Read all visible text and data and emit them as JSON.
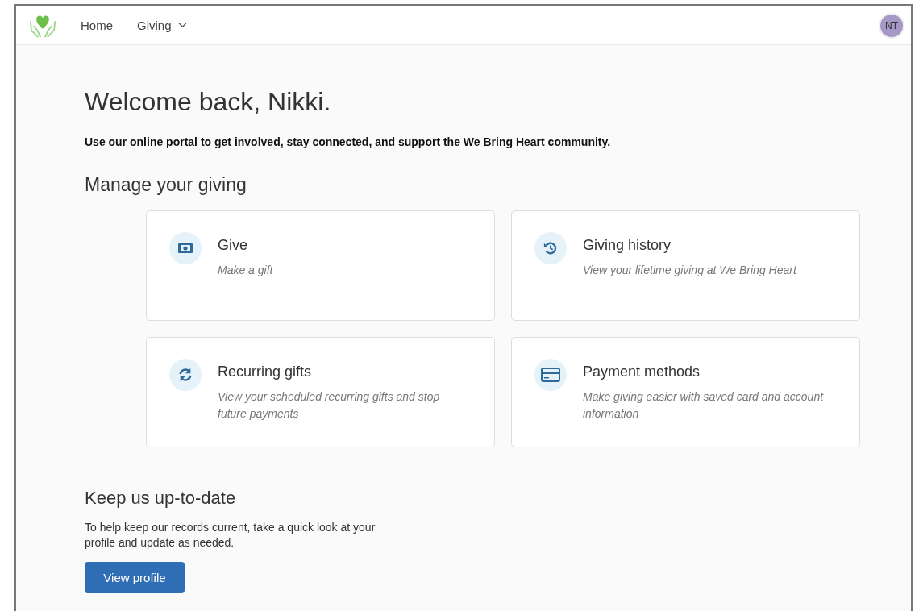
{
  "nav": {
    "items": [
      {
        "label": "Home",
        "kind": "link"
      },
      {
        "label": "Giving",
        "kind": "dropdown"
      }
    ],
    "avatar": "NT"
  },
  "welcome": "Welcome back, Nikki.",
  "intro": "Use our online portal to get involved, stay connected, and support the We Bring Heart community.",
  "manage": {
    "title": "Manage your giving",
    "cards": [
      {
        "kind": "give",
        "title": "Give",
        "description": "Make a gift"
      },
      {
        "kind": "history",
        "title": "Giving history",
        "description": "View your lifetime giving at We Bring Heart"
      },
      {
        "kind": "recurring",
        "title": "Recurring gifts",
        "description": "View your scheduled recurring gifts and stop future payments"
      },
      {
        "kind": "payment",
        "title": "Payment methods",
        "description": "Make giving easier with saved card and account information"
      }
    ]
  },
  "update": {
    "title": "Keep us up-to-date",
    "text": "To help keep our records current, take a quick look at your profile and update as needed.",
    "button": "View profile"
  }
}
